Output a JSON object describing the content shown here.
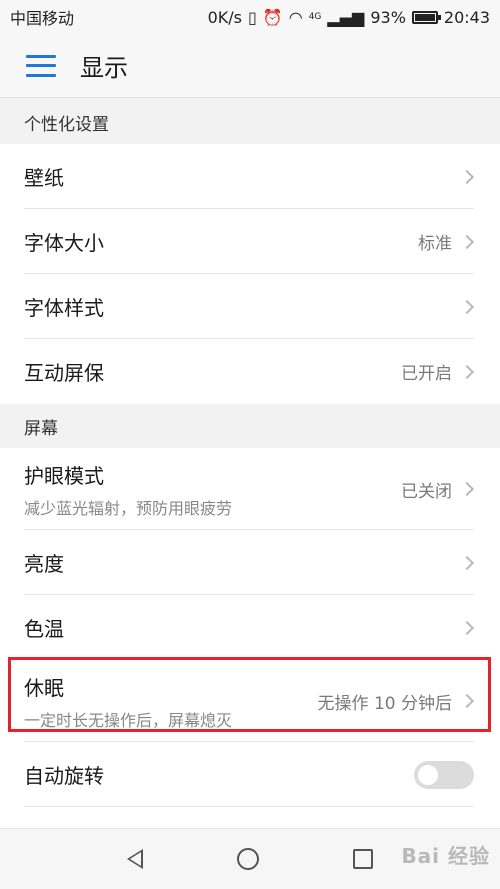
{
  "status_bar": {
    "carrier": "中国移动",
    "speed": "0K/s",
    "network": "4G",
    "battery": "93%",
    "time": "20:43"
  },
  "toolbar": {
    "title": "显示",
    "menu_icon": "hamburger-menu-icon"
  },
  "sections": {
    "personal": "个性化设置",
    "screen": "屏幕"
  },
  "rows": {
    "wallpaper": {
      "title": "壁纸"
    },
    "font_size": {
      "title": "字体大小",
      "value": "标准"
    },
    "font_style": {
      "title": "字体样式"
    },
    "screensaver": {
      "title": "互动屏保",
      "value": "已开启"
    },
    "eye_comfort": {
      "title": "护眼模式",
      "subtitle": "减少蓝光辐射，预防用眼疲劳",
      "value": "已关闭"
    },
    "brightness": {
      "title": "亮度"
    },
    "color_temp": {
      "title": "色温"
    },
    "sleep": {
      "title": "休眠",
      "subtitle": "一定时长无操作后，屏幕熄灭",
      "value": "无操作 10 分钟后"
    },
    "auto_rotate": {
      "title": "自动旋转",
      "enabled": false
    }
  },
  "watermark": "Bai 经验",
  "colors": {
    "accent": "#1d78d6",
    "highlight": "#e3222b"
  }
}
